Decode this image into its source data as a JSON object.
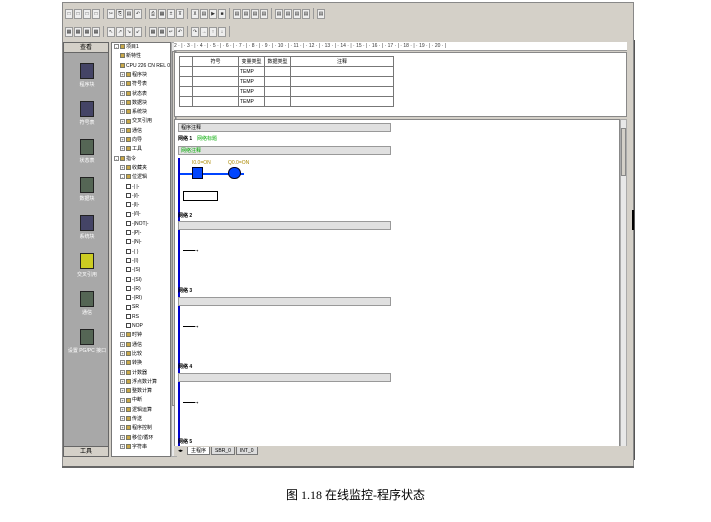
{
  "toolbar": {
    "row1": [
      "□",
      "□",
      "□",
      "□",
      "✂",
      "⎘",
      "▤",
      "↶",
      "⎙",
      "▦",
      "±",
      "⊼",
      "⊻",
      "▤",
      "▶",
      "■",
      "▤",
      "▤",
      "▤",
      "▤",
      "▤",
      "▤",
      "▤",
      "▤",
      "▤"
    ],
    "row2": [
      "▦",
      "▦",
      "▦",
      "▦",
      "↖",
      "↗",
      "↘",
      "↙",
      "▦",
      "▦",
      "↵",
      "↶",
      "↷",
      "→",
      "↑",
      "↓"
    ]
  },
  "nav": {
    "title": "查看",
    "footer": "工具",
    "items": [
      "程序块",
      "符号表",
      "状态表",
      "数据块",
      "系统块",
      "交叉引用",
      "通信",
      "设置 PG/PC 接口"
    ]
  },
  "tree": {
    "items": [
      {
        "t": "项目1",
        "lvl": 0,
        "box": "-"
      },
      {
        "t": "新特性",
        "lvl": 1,
        "box": ""
      },
      {
        "t": "CPU 226 CN REL 02.01",
        "lvl": 1,
        "box": ""
      },
      {
        "t": "程序块",
        "lvl": 1,
        "box": "+"
      },
      {
        "t": "符号表",
        "lvl": 1,
        "box": "+"
      },
      {
        "t": "状态表",
        "lvl": 1,
        "box": "+"
      },
      {
        "t": "数据块",
        "lvl": 1,
        "box": "+"
      },
      {
        "t": "系统块",
        "lvl": 1,
        "box": "+"
      },
      {
        "t": "交叉引用",
        "lvl": 1,
        "box": "+"
      },
      {
        "t": "通信",
        "lvl": 1,
        "box": "+"
      },
      {
        "t": "向导",
        "lvl": 1,
        "box": "+"
      },
      {
        "t": "工具",
        "lvl": 1,
        "box": "+"
      },
      {
        "t": "指令",
        "lvl": 0,
        "box": "-"
      },
      {
        "t": "收藏夹",
        "lvl": 1,
        "box": "+"
      },
      {
        "t": "位逻辑",
        "lvl": 1,
        "box": "-"
      },
      {
        "t": "-|   |-",
        "lvl": 2,
        "box": ""
      },
      {
        "t": "-|/|-",
        "lvl": 2,
        "box": ""
      },
      {
        "t": "-|I|-",
        "lvl": 2,
        "box": ""
      },
      {
        "t": "-|/I|-",
        "lvl": 2,
        "box": ""
      },
      {
        "t": "-|NOT|-",
        "lvl": 2,
        "box": ""
      },
      {
        "t": "-|P|-",
        "lvl": 2,
        "box": ""
      },
      {
        "t": "-|N|-",
        "lvl": 2,
        "box": ""
      },
      {
        "t": "-( )",
        "lvl": 2,
        "box": ""
      },
      {
        "t": "-(I)",
        "lvl": 2,
        "box": ""
      },
      {
        "t": "-(S)",
        "lvl": 2,
        "box": ""
      },
      {
        "t": "-(SI)",
        "lvl": 2,
        "box": ""
      },
      {
        "t": "-(R)",
        "lvl": 2,
        "box": ""
      },
      {
        "t": "-(RI)",
        "lvl": 2,
        "box": ""
      },
      {
        "t": "SR",
        "lvl": 2,
        "box": ""
      },
      {
        "t": "RS",
        "lvl": 2,
        "box": ""
      },
      {
        "t": "NOP",
        "lvl": 2,
        "box": ""
      },
      {
        "t": "时钟",
        "lvl": 1,
        "box": "+"
      },
      {
        "t": "通信",
        "lvl": 1,
        "box": "+"
      },
      {
        "t": "比较",
        "lvl": 1,
        "box": "+"
      },
      {
        "t": "转换",
        "lvl": 1,
        "box": "+"
      },
      {
        "t": "计数器",
        "lvl": 1,
        "box": "+"
      },
      {
        "t": "浮点数计算",
        "lvl": 1,
        "box": "+"
      },
      {
        "t": "整数计算",
        "lvl": 1,
        "box": "+"
      },
      {
        "t": "中断",
        "lvl": 1,
        "box": "+"
      },
      {
        "t": "逻辑运算",
        "lvl": 1,
        "box": "+"
      },
      {
        "t": "传送",
        "lvl": 1,
        "box": "+"
      },
      {
        "t": "程序控制",
        "lvl": 1,
        "box": "+"
      },
      {
        "t": "移位/循环",
        "lvl": 1,
        "box": "+"
      },
      {
        "t": "字符串",
        "lvl": 1,
        "box": "+"
      }
    ]
  },
  "ruler": "2 · | · 3 · | · 4 · | · 5 · | · 6 · | · 7 · | · 8 · | · 9 · | · 10 · | · 11 · | · 12 · | · 13 · | · 14 · | · 15 · | · 16 · | · 17 · | · 18 · | · 19 · | · 20 · |",
  "vartable": {
    "headers": [
      "",
      "符号",
      "变量类型",
      "数据类型",
      "注释"
    ],
    "rows": [
      [
        "",
        "",
        "TEMP",
        "",
        ""
      ],
      [
        "",
        "",
        "TEMP",
        "",
        ""
      ],
      [
        "",
        "",
        "TEMP",
        "",
        ""
      ],
      [
        "",
        "",
        "TEMP",
        "",
        ""
      ]
    ]
  },
  "editor": {
    "program_comment": "程序注释",
    "networks": [
      {
        "label": "网络 1",
        "title": "网络标题",
        "comment": "网络注释",
        "contact1": "I0.0=ON",
        "contact2": "Q0.0=ON"
      },
      {
        "label": "网络 2",
        "title": "",
        "comment": ""
      },
      {
        "label": "网络 3",
        "title": "",
        "comment": ""
      },
      {
        "label": "网络 4",
        "title": "",
        "comment": ""
      },
      {
        "label": "网络 5",
        "title": "",
        "comment": ""
      }
    ]
  },
  "tabs": [
    "主程序",
    "SBR_0",
    "INT_0"
  ],
  "caption": "图 1.18    在线监控-程序状态",
  "colors": {
    "rail": "#0000cc",
    "active_element": "#0044ff",
    "comment_green": "#00aa00"
  }
}
